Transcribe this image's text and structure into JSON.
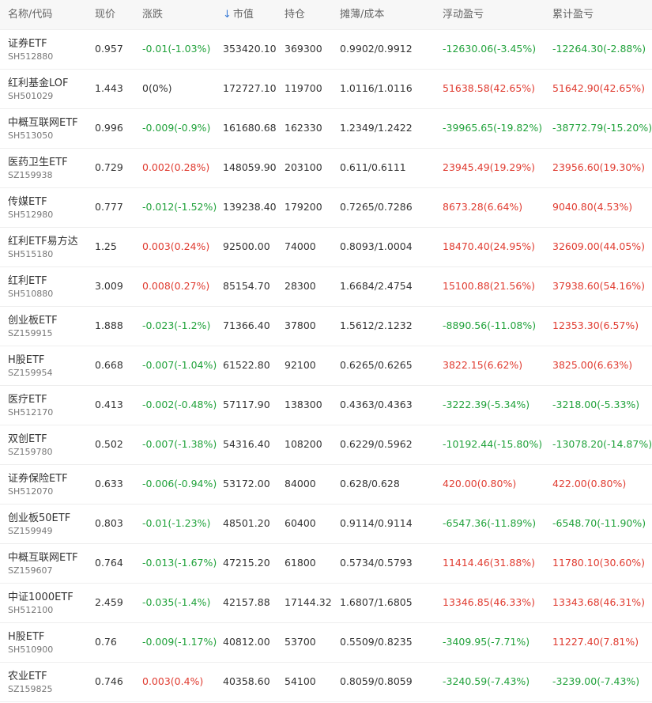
{
  "header": {
    "name_code": "名称/代码",
    "price": "现价",
    "change": "涨跌",
    "market_value": "市值",
    "holding": "持仓",
    "cost": "摊薄/成本",
    "floating_pl": "浮动盈亏",
    "accum_pl": "累计盈亏"
  },
  "colors": {
    "up": "#e03c31",
    "down": "#21a23b",
    "neutral": "#333333",
    "sort_arrow": "#3a7bd5"
  },
  "rows": [
    {
      "name": "证券ETF",
      "code": "SH512880",
      "price": "0.957",
      "change": "-0.01(-1.03%)",
      "change_dir": "neg",
      "market_value": "353420.10",
      "holding": "369300",
      "cost": "0.9902/0.9912",
      "floating": "-12630.06(-3.45%)",
      "floating_dir": "neg",
      "accum": "-12264.30(-2.88%)",
      "accum_dir": "neg"
    },
    {
      "name": "红利基金LOF",
      "code": "SH501029",
      "price": "1.443",
      "change": "0(0%)",
      "change_dir": "neu",
      "market_value": "172727.10",
      "holding": "119700",
      "cost": "1.0116/1.0116",
      "floating": "51638.58(42.65%)",
      "floating_dir": "pos",
      "accum": "51642.90(42.65%)",
      "accum_dir": "pos"
    },
    {
      "name": "中概互联网ETF",
      "code": "SH513050",
      "price": "0.996",
      "change": "-0.009(-0.9%)",
      "change_dir": "neg",
      "market_value": "161680.68",
      "holding": "162330",
      "cost": "1.2349/1.2422",
      "floating": "-39965.65(-19.82%)",
      "floating_dir": "neg",
      "accum": "-38772.79(-15.20%)",
      "accum_dir": "neg"
    },
    {
      "name": "医药卫生ETF",
      "code": "SZ159938",
      "price": "0.729",
      "change": "0.002(0.28%)",
      "change_dir": "pos",
      "market_value": "148059.90",
      "holding": "203100",
      "cost": "0.611/0.6111",
      "floating": "23945.49(19.29%)",
      "floating_dir": "pos",
      "accum": "23956.60(19.30%)",
      "accum_dir": "pos"
    },
    {
      "name": "传媒ETF",
      "code": "SH512980",
      "price": "0.777",
      "change": "-0.012(-1.52%)",
      "change_dir": "neg",
      "market_value": "139238.40",
      "holding": "179200",
      "cost": "0.7265/0.7286",
      "floating": "8673.28(6.64%)",
      "floating_dir": "pos",
      "accum": "9040.80(4.53%)",
      "accum_dir": "pos"
    },
    {
      "name": "红利ETF易方达",
      "code": "SH515180",
      "price": "1.25",
      "change": "0.003(0.24%)",
      "change_dir": "pos",
      "market_value": "92500.00",
      "holding": "74000",
      "cost": "0.8093/1.0004",
      "floating": "18470.40(24.95%)",
      "floating_dir": "pos",
      "accum": "32609.00(44.05%)",
      "accum_dir": "pos"
    },
    {
      "name": "红利ETF",
      "code": "SH510880",
      "price": "3.009",
      "change": "0.008(0.27%)",
      "change_dir": "pos",
      "market_value": "85154.70",
      "holding": "28300",
      "cost": "1.6684/2.4754",
      "floating": "15100.88(21.56%)",
      "floating_dir": "pos",
      "accum": "37938.60(54.16%)",
      "accum_dir": "pos"
    },
    {
      "name": "创业板ETF",
      "code": "SZ159915",
      "price": "1.888",
      "change": "-0.023(-1.2%)",
      "change_dir": "neg",
      "market_value": "71366.40",
      "holding": "37800",
      "cost": "1.5612/2.1232",
      "floating": "-8890.56(-11.08%)",
      "floating_dir": "neg",
      "accum": "12353.30(6.57%)",
      "accum_dir": "pos"
    },
    {
      "name": "H股ETF",
      "code": "SZ159954",
      "price": "0.668",
      "change": "-0.007(-1.04%)",
      "change_dir": "neg",
      "market_value": "61522.80",
      "holding": "92100",
      "cost": "0.6265/0.6265",
      "floating": "3822.15(6.62%)",
      "floating_dir": "pos",
      "accum": "3825.00(6.63%)",
      "accum_dir": "pos"
    },
    {
      "name": "医疗ETF",
      "code": "SH512170",
      "price": "0.413",
      "change": "-0.002(-0.48%)",
      "change_dir": "neg",
      "market_value": "57117.90",
      "holding": "138300",
      "cost": "0.4363/0.4363",
      "floating": "-3222.39(-5.34%)",
      "floating_dir": "neg",
      "accum": "-3218.00(-5.33%)",
      "accum_dir": "neg"
    },
    {
      "name": "双创ETF",
      "code": "SZ159780",
      "price": "0.502",
      "change": "-0.007(-1.38%)",
      "change_dir": "neg",
      "market_value": "54316.40",
      "holding": "108200",
      "cost": "0.6229/0.5962",
      "floating": "-10192.44(-15.80%)",
      "floating_dir": "neg",
      "accum": "-13078.20(-14.87%)",
      "accum_dir": "neg"
    },
    {
      "name": "证券保险ETF",
      "code": "SH512070",
      "price": "0.633",
      "change": "-0.006(-0.94%)",
      "change_dir": "neg",
      "market_value": "53172.00",
      "holding": "84000",
      "cost": "0.628/0.628",
      "floating": "420.00(0.80%)",
      "floating_dir": "pos",
      "accum": "422.00(0.80%)",
      "accum_dir": "pos"
    },
    {
      "name": "创业板50ETF",
      "code": "SZ159949",
      "price": "0.803",
      "change": "-0.01(-1.23%)",
      "change_dir": "neg",
      "market_value": "48501.20",
      "holding": "60400",
      "cost": "0.9114/0.9114",
      "floating": "-6547.36(-11.89%)",
      "floating_dir": "neg",
      "accum": "-6548.70(-11.90%)",
      "accum_dir": "neg"
    },
    {
      "name": "中概互联网ETF",
      "code": "SZ159607",
      "price": "0.764",
      "change": "-0.013(-1.67%)",
      "change_dir": "neg",
      "market_value": "47215.20",
      "holding": "61800",
      "cost": "0.5734/0.5793",
      "floating": "11414.46(31.88%)",
      "floating_dir": "pos",
      "accum": "11780.10(30.60%)",
      "accum_dir": "pos"
    },
    {
      "name": "中证1000ETF",
      "code": "SH512100",
      "price": "2.459",
      "change": "-0.035(-1.4%)",
      "change_dir": "neg",
      "market_value": "42157.88",
      "holding": "17144.32",
      "cost": "1.6807/1.6805",
      "floating": "13346.85(46.33%)",
      "floating_dir": "pos",
      "accum": "13343.68(46.31%)",
      "accum_dir": "pos"
    },
    {
      "name": "H股ETF",
      "code": "SH510900",
      "price": "0.76",
      "change": "-0.009(-1.17%)",
      "change_dir": "neg",
      "market_value": "40812.00",
      "holding": "53700",
      "cost": "0.5509/0.8235",
      "floating": "-3409.95(-7.71%)",
      "floating_dir": "neg",
      "accum": "11227.40(7.81%)",
      "accum_dir": "pos"
    },
    {
      "name": "农业ETF",
      "code": "SZ159825",
      "price": "0.746",
      "change": "0.003(0.4%)",
      "change_dir": "pos",
      "market_value": "40358.60",
      "holding": "54100",
      "cost": "0.8059/0.8059",
      "floating": "-3240.59(-7.43%)",
      "floating_dir": "neg",
      "accum": "-3239.00(-7.43%)",
      "accum_dir": "neg"
    }
  ]
}
